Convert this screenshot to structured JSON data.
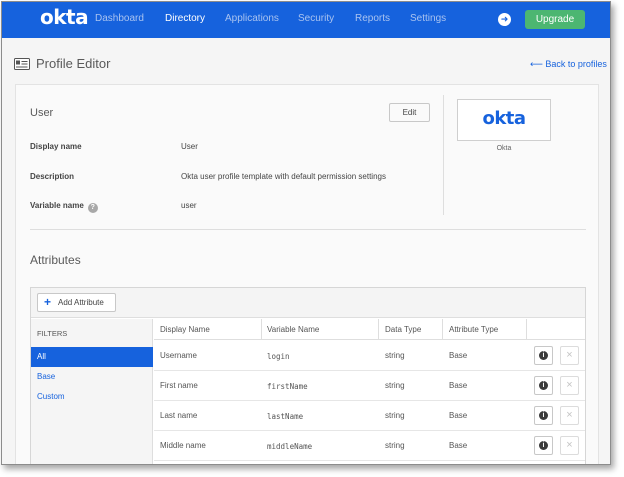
{
  "nav": {
    "logo": "okta",
    "items": [
      {
        "label": "Dashboard",
        "active": false
      },
      {
        "label": "Directory",
        "active": true
      },
      {
        "label": "Applications",
        "active": false
      },
      {
        "label": "Security",
        "active": false
      },
      {
        "label": "Reports",
        "active": false
      },
      {
        "label": "Settings",
        "active": false
      }
    ],
    "upgrade_label": "Upgrade"
  },
  "page": {
    "title": "Profile Editor",
    "back_link": "⟵ Back to profiles"
  },
  "profile": {
    "name": "User",
    "edit_label": "Edit",
    "fields": [
      {
        "label": "Display name",
        "value": "User"
      },
      {
        "label": "Description",
        "value": "Okta user profile template with default permission settings"
      },
      {
        "label": "Variable name",
        "value": "user"
      }
    ],
    "logo_text": "okta",
    "logo_caption": "Okta"
  },
  "attributes": {
    "title": "Attributes",
    "add_label": "Add Attribute",
    "filters_heading": "FILTERS",
    "filters": [
      "All",
      "Base",
      "Custom"
    ],
    "columns": [
      "Display Name",
      "Variable Name",
      "Data Type",
      "Attribute Type"
    ],
    "rows": [
      {
        "display": "Username",
        "variable": "login",
        "type": "string",
        "attr_type": "Base"
      },
      {
        "display": "First name",
        "variable": "firstName",
        "type": "string",
        "attr_type": "Base"
      },
      {
        "display": "Last name",
        "variable": "lastName",
        "type": "string",
        "attr_type": "Base"
      },
      {
        "display": "Middle name",
        "variable": "middleName",
        "type": "string",
        "attr_type": "Base"
      }
    ]
  },
  "colors": {
    "brand": "#1662dd",
    "upgrade": "#4cb671"
  },
  "icons": [
    "profile-editor-icon",
    "arrow-right-icon",
    "help-icon",
    "plus-icon",
    "info-icon",
    "close-icon"
  ]
}
